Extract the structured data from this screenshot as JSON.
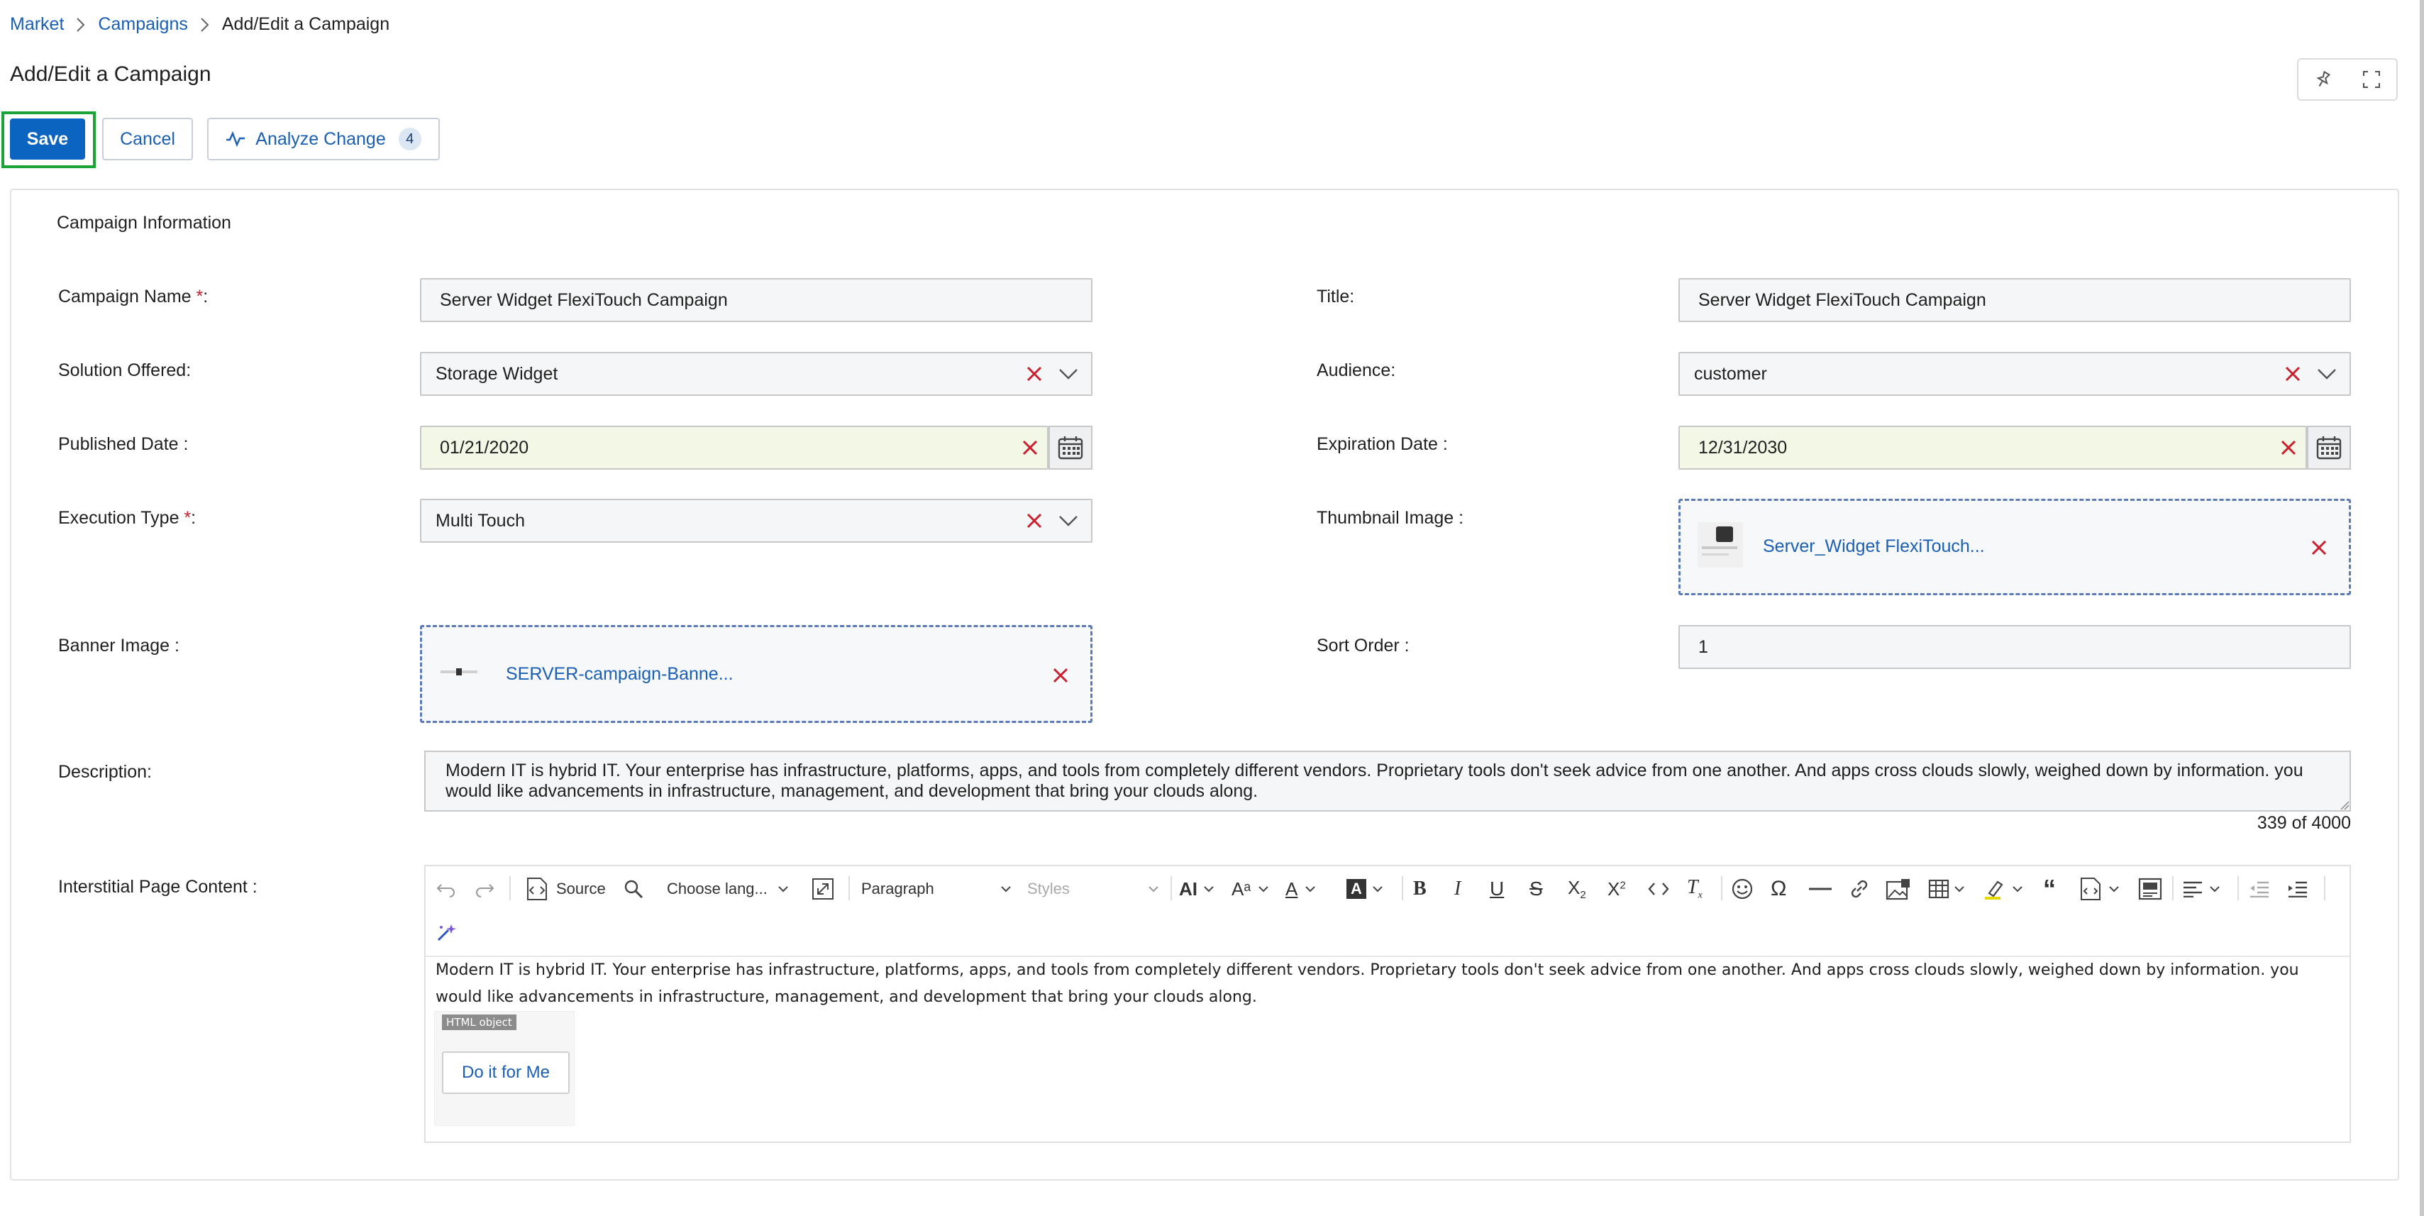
{
  "breadcrumb": {
    "items": [
      "Market",
      "Campaigns",
      "Add/Edit a Campaign"
    ]
  },
  "page": {
    "title": "Add/Edit a Campaign"
  },
  "actions": {
    "save_label": "Save",
    "cancel_label": "Cancel",
    "analyze_label": "Analyze Change",
    "analyze_count": "4"
  },
  "form": {
    "section_title": "Campaign Information",
    "campaign_name": {
      "label": "Campaign Name ",
      "required_mark": "*",
      "suffix": ":",
      "value": "Server Widget FlexiTouch Campaign"
    },
    "title": {
      "label": "Title:",
      "value": "Server Widget FlexiTouch Campaign"
    },
    "solution_offered": {
      "label": "Solution Offered:",
      "value": "Storage Widget"
    },
    "audience": {
      "label": "Audience:",
      "value": "customer"
    },
    "published_date": {
      "label": "Published Date :",
      "value": "01/21/2020"
    },
    "expiration_date": {
      "label": "Expiration Date :",
      "value": "12/31/2030"
    },
    "execution_type": {
      "label": "Execution Type ",
      "required_mark": "*",
      "suffix": ":",
      "value": "Multi Touch"
    },
    "thumbnail_image": {
      "label": "Thumbnail Image :",
      "file": "Server_Widget FlexiTouch..."
    },
    "banner_image": {
      "label": "Banner Image :",
      "file": "SERVER-campaign-Banne..."
    },
    "sort_order": {
      "label": "Sort Order :",
      "value": "1"
    },
    "description": {
      "label": "Description:",
      "value": "Modern IT is hybrid IT. Your enterprise has infrastructure, platforms, apps, and tools from completely different vendors. Proprietary tools don't seek advice from one another. And apps cross clouds slowly, weighed down by information. you would like advancements in infrastructure, management, and development that bring your clouds along.",
      "counter": "339 of 4000"
    },
    "interstitial": {
      "label": "Interstitial Page Content :",
      "toolbar": {
        "source_label": "Source",
        "language_label": "Choose lang...",
        "paragraph_label": "Paragraph",
        "styles_label": "Styles"
      },
      "body_text": "Modern IT is hybrid IT. Your enterprise has infrastructure, platforms, apps, and tools from completely different vendors. Proprietary tools don't seek advice from one another. And apps cross clouds slowly, weighed down by information. you would like advancements in infrastructure, management, and development that bring your clouds along.",
      "html_object_tag": "HTML object",
      "cta_label": "Do it for Me"
    }
  },
  "colors": {
    "primary": "#0b64c0",
    "highlight_border": "#1aa336",
    "clear_icon": "#c8202e",
    "link": "#1a5fb4"
  }
}
